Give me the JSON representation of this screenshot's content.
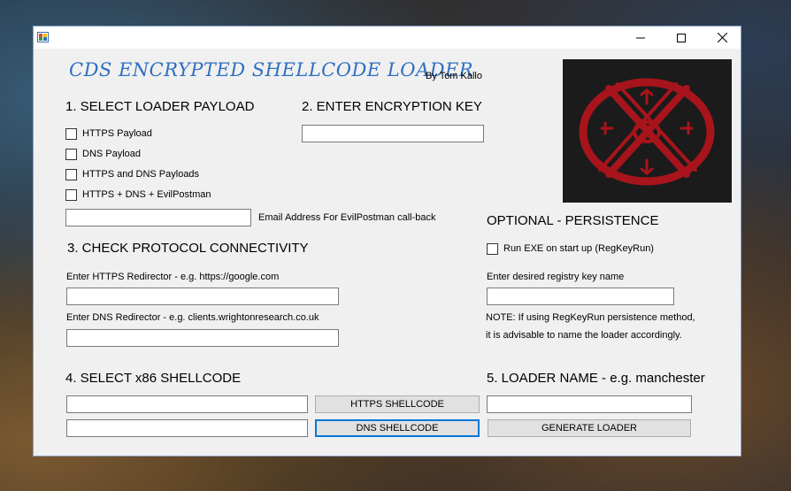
{
  "window": {
    "title": "",
    "controls": {
      "minimize": "—",
      "maximize": "☐",
      "close": "✕"
    }
  },
  "app": {
    "title": "CDS ENCRYPTED SHELLCODE LOADER",
    "author": "By Tom Kallo"
  },
  "section1": {
    "heading": "1. SELECT LOADER PAYLOAD",
    "options": [
      {
        "label": "HTTPS Payload",
        "checked": false
      },
      {
        "label": "DNS Payload",
        "checked": false
      },
      {
        "label": "HTTPS and DNS Payloads",
        "checked": false
      },
      {
        "label": "HTTPS + DNS + EvilPostman",
        "checked": false
      }
    ],
    "email_value": "",
    "email_label": "Email Address For EvilPostman call-back"
  },
  "section2": {
    "heading": "2. ENTER ENCRYPTION KEY",
    "key_value": ""
  },
  "section3": {
    "heading": "3. CHECK PROTOCOL CONNECTIVITY",
    "https_label": "Enter HTTPS Redirector  - e.g. https://google.com",
    "https_value": "",
    "dns_label": "Enter DNS Redirector - e.g. clients.wrightonresearch.co.uk",
    "dns_value": ""
  },
  "persistence": {
    "heading": "OPTIONAL - PERSISTENCE",
    "checkbox_label": "Run EXE on start up (RegKeyRun)",
    "checked": false,
    "regkey_label": "Enter desired registry key name",
    "regkey_value": "",
    "note_line1": "NOTE: If using RegKeyRun persistence method,",
    "note_line2": "it is advisable to name the loader accordingly."
  },
  "section4": {
    "heading": "4. SELECT x86 SHELLCODE",
    "https_path": "",
    "dns_path": "",
    "https_button": "HTTPS SHELLCODE",
    "dns_button": "DNS SHELLCODE"
  },
  "section5": {
    "heading": "5. LOADER NAME - e.g. manchester",
    "name_value": "",
    "generate_button": "GENERATE LOADER"
  },
  "colors": {
    "title_blue": "#2e6fc0",
    "logo_red": "#a8141b",
    "logo_bg": "#1b1b1b",
    "focus": "#0078d7"
  },
  "logo_icon": "ouroboros-x-emblem-icon"
}
